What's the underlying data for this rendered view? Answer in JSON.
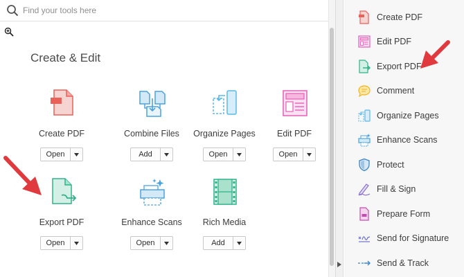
{
  "search": {
    "placeholder": "Find your tools here"
  },
  "main": {
    "section_title": "Create & Edit",
    "tools": [
      {
        "name": "Create PDF",
        "button": "Open",
        "icon": "create-pdf-icon",
        "color": "#e8625a"
      },
      {
        "name": "Combine Files",
        "button": "Add",
        "icon": "combine-files-icon",
        "color": "#4aa3df"
      },
      {
        "name": "Organize Pages",
        "button": "Open",
        "icon": "organize-pages-icon",
        "color": "#5bb8e8"
      },
      {
        "name": "Edit PDF",
        "button": "Open",
        "icon": "edit-pdf-icon",
        "color": "#e65fb6"
      },
      {
        "name": "Export PDF",
        "button": "Open",
        "icon": "export-pdf-icon",
        "color": "#2fb28a"
      },
      {
        "name": "Enhance Scans",
        "button": "Open",
        "icon": "enhance-scans-icon",
        "color": "#4aa3df"
      },
      {
        "name": "Rich Media",
        "button": "Add",
        "icon": "rich-media-icon",
        "color": "#2fb28a"
      }
    ]
  },
  "right_panel": {
    "items": [
      {
        "label": "Create PDF",
        "icon": "create-pdf-icon",
        "color": "#e8625a"
      },
      {
        "label": "Edit PDF",
        "icon": "edit-pdf-icon",
        "color": "#e65fb6"
      },
      {
        "label": "Export PDF",
        "icon": "export-pdf-icon",
        "color": "#2fb28a"
      },
      {
        "label": "Comment",
        "icon": "comment-icon",
        "color": "#f2b31b"
      },
      {
        "label": "Organize Pages",
        "icon": "organize-pages-icon",
        "color": "#5bb8e8"
      },
      {
        "label": "Enhance Scans",
        "icon": "enhance-scans-icon",
        "color": "#4aa3df"
      },
      {
        "label": "Protect",
        "icon": "protect-icon",
        "color": "#3d86c6"
      },
      {
        "label": "Fill & Sign",
        "icon": "fill-sign-icon",
        "color": "#8a6fd1"
      },
      {
        "label": "Prepare Form",
        "icon": "prepare-form-icon",
        "color": "#c44cb0"
      },
      {
        "label": "Send for Signature",
        "icon": "send-for-signature-icon",
        "color": "#6b6fcf"
      },
      {
        "label": "Send & Track",
        "icon": "send-track-icon",
        "color": "#3d86c6"
      }
    ]
  },
  "annotation_color": "#e0393e"
}
